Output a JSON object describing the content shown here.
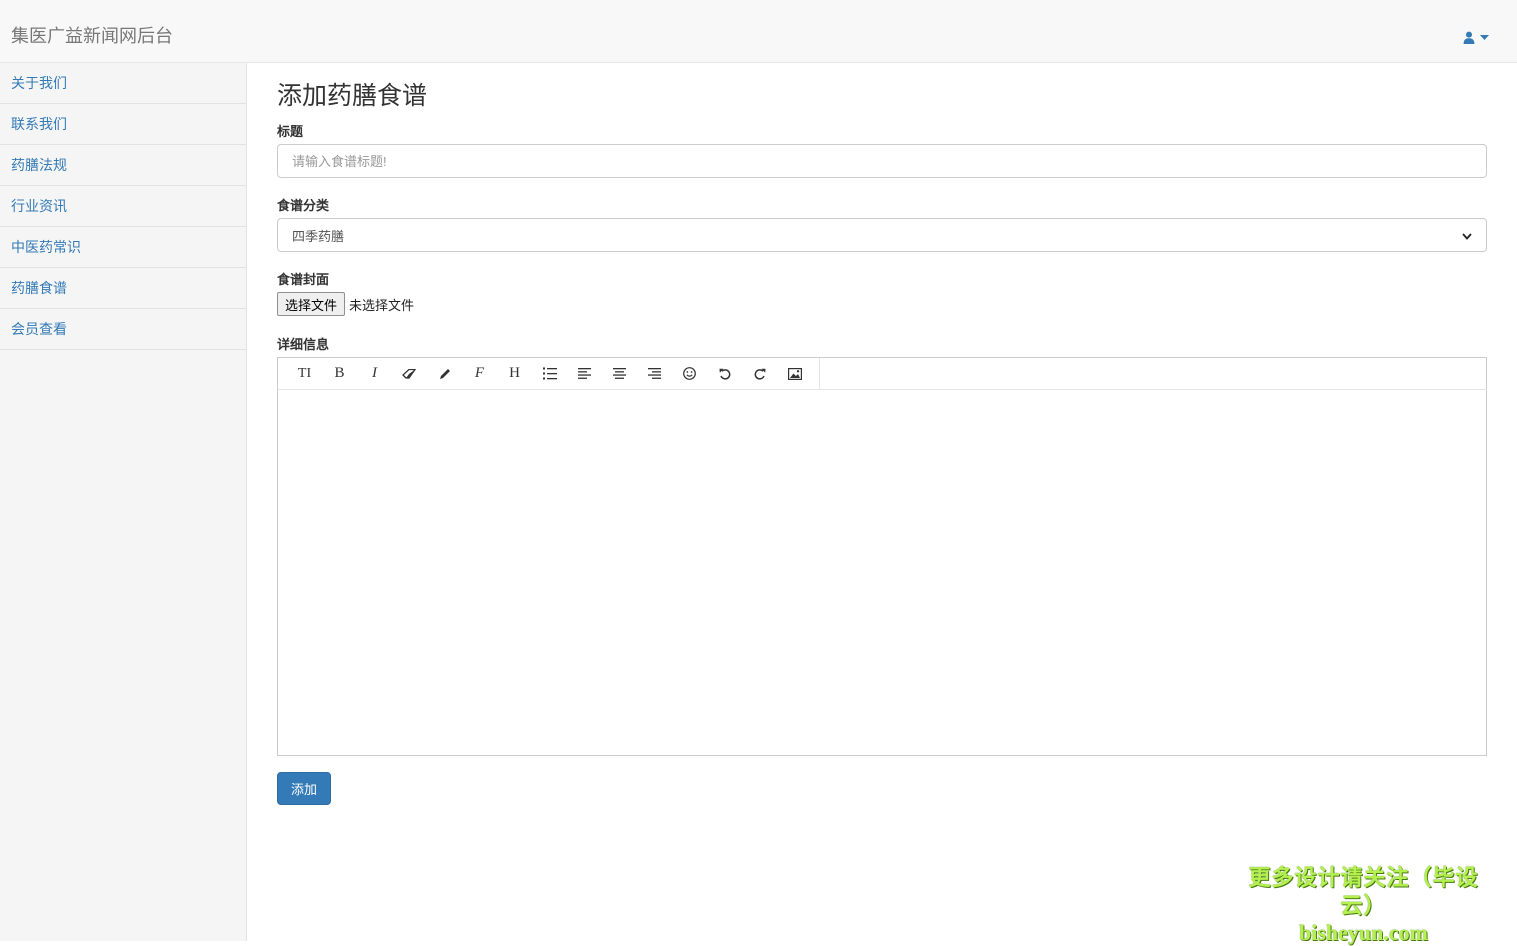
{
  "navbar": {
    "brand": "集医广益新闻网后台",
    "user_icon": "user-icon",
    "caret_icon": "caret-down-icon",
    "accent": "#337ab7"
  },
  "sidebar": {
    "items": [
      {
        "label": "关于我们"
      },
      {
        "label": "联系我们"
      },
      {
        "label": "药膳法规"
      },
      {
        "label": "行业资讯"
      },
      {
        "label": "中医药常识"
      },
      {
        "label": "药膳食谱"
      },
      {
        "label": "会员查看"
      }
    ]
  },
  "form": {
    "title": "添加药膳食谱",
    "title_field": {
      "label": "标题",
      "placeholder": "请输入食谱标题!",
      "value": ""
    },
    "category_field": {
      "label": "食谱分类",
      "selected": "四季药膳"
    },
    "cover_field": {
      "label": "食谱封面",
      "button": "选择文件",
      "status": "未选择文件"
    },
    "detail_field": {
      "label": "详细信息",
      "content": ""
    },
    "toolbar": [
      {
        "name": "font-size-icon",
        "glyph": "TI"
      },
      {
        "name": "bold-icon",
        "glyph": "B"
      },
      {
        "name": "italic-icon",
        "glyph": "I"
      },
      {
        "name": "eraser-icon",
        "glyph": ""
      },
      {
        "name": "pencil-icon",
        "glyph": ""
      },
      {
        "name": "font-icon",
        "glyph": "F"
      },
      {
        "name": "heading-icon",
        "glyph": "H"
      },
      {
        "name": "ordered-list-icon",
        "glyph": ""
      },
      {
        "name": "align-left-icon",
        "glyph": ""
      },
      {
        "name": "align-center-icon",
        "glyph": ""
      },
      {
        "name": "align-right-icon",
        "glyph": ""
      },
      {
        "name": "emoji-icon",
        "glyph": ""
      },
      {
        "name": "undo-icon",
        "glyph": ""
      },
      {
        "name": "redo-icon",
        "glyph": ""
      },
      {
        "name": "image-icon",
        "glyph": ""
      }
    ],
    "submit_label": "添加"
  },
  "watermark": {
    "line1": "更多设计请关注（毕设云）",
    "line2": "bisheyun.com",
    "color": "#b4f050"
  }
}
